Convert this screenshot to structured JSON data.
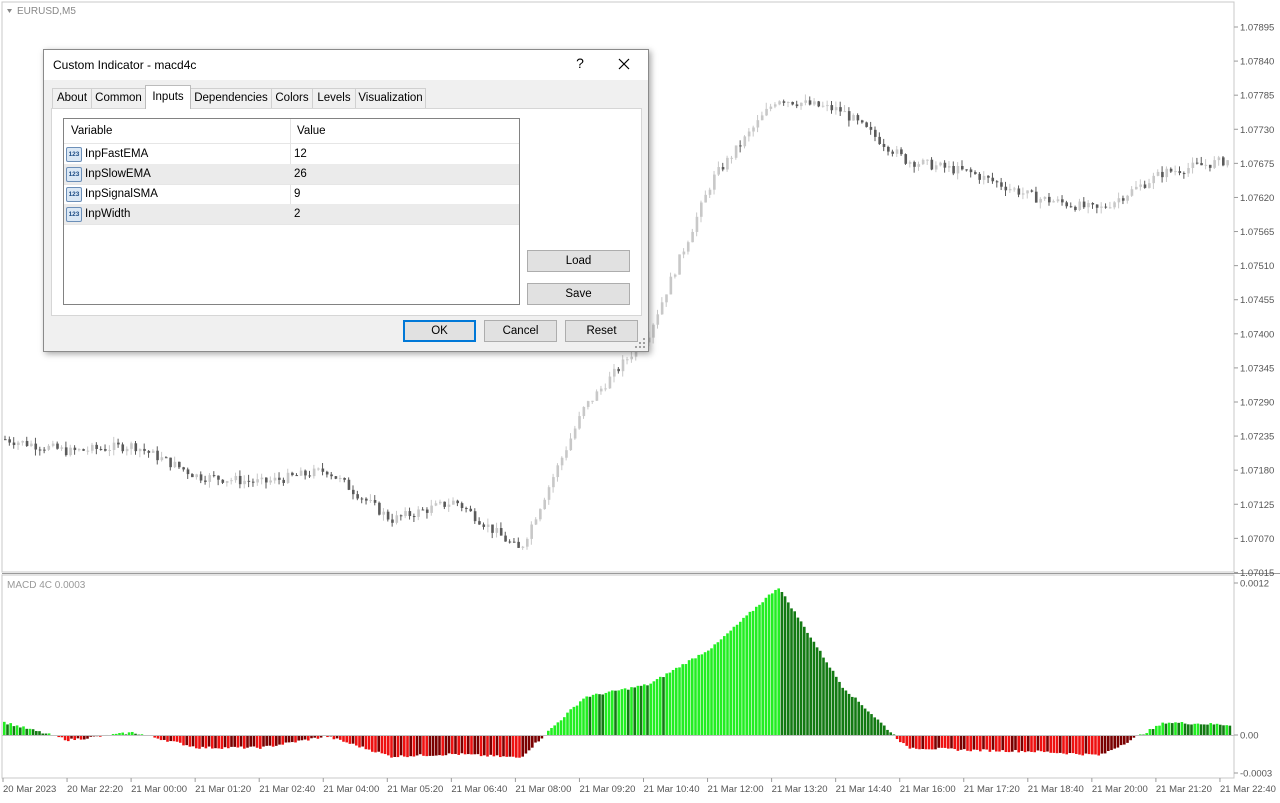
{
  "chart": {
    "symbol_label": "EURUSD,M5",
    "indicator_label": "MACD 4C 0.0003",
    "price_axis": [
      "1.07895",
      "1.07840",
      "1.07785",
      "1.07730",
      "1.07675",
      "1.07620",
      "1.07565",
      "1.07510",
      "1.07455",
      "1.07400",
      "1.07345",
      "1.07290",
      "1.07235",
      "1.07180",
      "1.07125",
      "1.07070",
      "1.07015"
    ],
    "indicator_axis": [
      "0.0012",
      "0.00",
      "-0.0003"
    ],
    "time_axis": [
      "20 Mar 2023",
      "20 Mar 22:20",
      "21 Mar 00:00",
      "21 Mar 01:20",
      "21 Mar 02:40",
      "21 Mar 04:00",
      "21 Mar 05:20",
      "21 Mar 06:40",
      "21 Mar 08:00",
      "21 Mar 09:20",
      "21 Mar 10:40",
      "21 Mar 12:00",
      "21 Mar 13:20",
      "21 Mar 14:40",
      "21 Mar 16:00",
      "21 Mar 17:20",
      "21 Mar 18:40",
      "21 Mar 20:00",
      "21 Mar 21:20",
      "21 Mar 22:40"
    ],
    "colors": {
      "bull_candle": "#c8c8c8",
      "bear_candle": "#5a5a5a",
      "up_rising": "#22ee22",
      "up_falling": "#137a13",
      "down_falling": "#ee1111",
      "down_rising": "#7a0000"
    }
  },
  "chart_data": [
    {
      "type": "candlestick",
      "title": "EURUSD,M5",
      "xlabel": "",
      "ylabel": "",
      "ylim": [
        1.0699,
        1.0792
      ],
      "close_keypoints": [
        {
          "time": "20 Mar 2023",
          "value": 1.0723
        },
        {
          "time": "20 Mar 22:20",
          "value": 1.0721
        },
        {
          "time": "21 Mar 00:00",
          "value": 1.0722
        },
        {
          "time": "21 Mar 01:20",
          "value": 1.0717
        },
        {
          "time": "21 Mar 02:40",
          "value": 1.0716
        },
        {
          "time": "21 Mar 04:00",
          "value": 1.0718
        },
        {
          "time": "21 Mar 05:20",
          "value": 1.071
        },
        {
          "time": "21 Mar 06:40",
          "value": 1.0713
        },
        {
          "time": "21 Mar 08:00",
          "value": 1.0705
        },
        {
          "time": "21 Mar 09:20",
          "value": 1.0728
        },
        {
          "time": "21 Mar 10:40",
          "value": 1.074
        },
        {
          "time": "21 Mar 12:00",
          "value": 1.0765
        },
        {
          "time": "21 Mar 13:20",
          "value": 1.0778
        },
        {
          "time": "21 Mar 14:40",
          "value": 1.0776
        },
        {
          "time": "21 Mar 16:00",
          "value": 1.0768
        },
        {
          "time": "21 Mar 17:20",
          "value": 1.0766
        },
        {
          "time": "21 Mar 18:40",
          "value": 1.0762
        },
        {
          "time": "21 Mar 20:00",
          "value": 1.076
        },
        {
          "time": "21 Mar 21:20",
          "value": 1.0766
        },
        {
          "time": "21 Mar 22:40",
          "value": 1.0768
        }
      ]
    },
    {
      "type": "bar",
      "title": "MACD 4C 0.0003",
      "xlabel": "",
      "ylabel": "",
      "ylim": [
        -0.0003,
        0.0012
      ],
      "histogram_keypoints": [
        {
          "time": "20 Mar 2023",
          "value": 0.0001
        },
        {
          "time": "20 Mar 22:20",
          "value": -4e-05
        },
        {
          "time": "21 Mar 00:00",
          "value": 2e-05
        },
        {
          "time": "21 Mar 01:20",
          "value": -0.0001
        },
        {
          "time": "21 Mar 02:40",
          "value": -0.0001
        },
        {
          "time": "21 Mar 04:00",
          "value": -1e-05
        },
        {
          "time": "21 Mar 05:20",
          "value": -0.00017
        },
        {
          "time": "21 Mar 06:40",
          "value": -0.00015
        },
        {
          "time": "21 Mar 08:00",
          "value": -0.00018
        },
        {
          "time": "21 Mar 09:20",
          "value": 0.0003
        },
        {
          "time": "21 Mar 10:40",
          "value": 0.0004
        },
        {
          "time": "21 Mar 12:00",
          "value": 0.0007
        },
        {
          "time": "21 Mar 13:20",
          "value": 0.00117
        },
        {
          "time": "21 Mar 14:40",
          "value": 0.00038
        },
        {
          "time": "21 Mar 16:00",
          "value": -0.0001
        },
        {
          "time": "21 Mar 17:20",
          "value": -0.00012
        },
        {
          "time": "21 Mar 18:40",
          "value": -0.00013
        },
        {
          "time": "21 Mar 20:00",
          "value": -0.00016
        },
        {
          "time": "21 Mar 21:20",
          "value": 0.0001
        },
        {
          "time": "21 Mar 22:40",
          "value": 8e-05
        }
      ]
    }
  ],
  "dialog": {
    "title": "Custom Indicator - macd4c",
    "help": "?",
    "tabs": [
      "About",
      "Common",
      "Inputs",
      "Dependencies",
      "Colors",
      "Levels",
      "Visualization"
    ],
    "active_tab": "Inputs",
    "grid": {
      "headers": {
        "variable": "Variable",
        "value": "Value"
      },
      "icon_text": "123",
      "rows": [
        {
          "variable": "InpFastEMA",
          "value": "12"
        },
        {
          "variable": "InpSlowEMA",
          "value": "26"
        },
        {
          "variable": "InpSignalSMA",
          "value": "9"
        },
        {
          "variable": "InpWidth",
          "value": "2"
        }
      ]
    },
    "buttons": {
      "load": "Load",
      "save": "Save",
      "ok": "OK",
      "cancel": "Cancel",
      "reset": "Reset"
    }
  }
}
